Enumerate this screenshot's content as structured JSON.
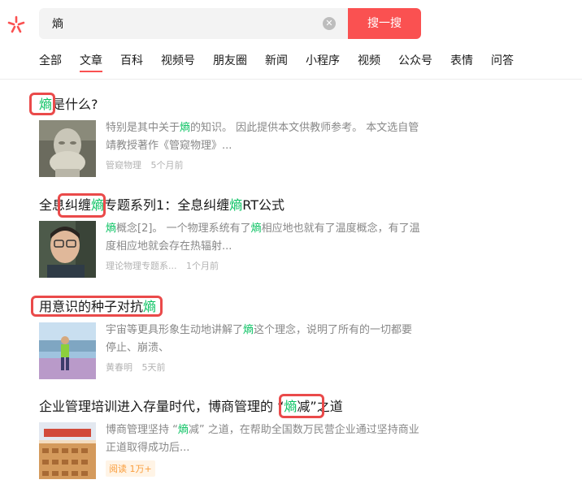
{
  "search": {
    "query": "熵",
    "button_label": "搜一搜"
  },
  "tabs": [
    "全部",
    "文章",
    "百科",
    "视频号",
    "朋友圈",
    "新闻",
    "小程序",
    "视频",
    "公众号",
    "表情",
    "问答"
  ],
  "results": [
    {
      "title_parts": [
        {
          "t": "熵",
          "h": true
        },
        {
          "t": "是什么?",
          "h": false
        }
      ],
      "snippet_parts": [
        {
          "t": "特别是其中关于",
          "h": false
        },
        {
          "t": "熵",
          "h": true
        },
        {
          "t": "的知识。 因此提供本文供教师参考。 本文选自管靖教授著作《管窥物理》...",
          "h": false
        }
      ],
      "source": "管窥物理",
      "time": "5个月前"
    },
    {
      "title_parts": [
        {
          "t": "全息纠缠",
          "h": false
        },
        {
          "t": "熵",
          "h": true
        },
        {
          "t": "专题系列1：全息纠缠",
          "h": false
        },
        {
          "t": "熵",
          "h": true
        },
        {
          "t": "RT公式",
          "h": false
        }
      ],
      "snippet_parts": [
        {
          "t": "熵",
          "h": true
        },
        {
          "t": "概念[2]。 一个物理系统有了",
          "h": false
        },
        {
          "t": "熵",
          "h": true
        },
        {
          "t": "相应地也就有了温度概念，有了温度相应地就会存在热辐射...",
          "h": false
        }
      ],
      "source": "理论物理专题系...",
      "time": "1个月前"
    },
    {
      "title_parts": [
        {
          "t": "用意识的种子对抗",
          "h": false
        },
        {
          "t": "熵",
          "h": true
        }
      ],
      "snippet_parts": [
        {
          "t": "宇宙等更具形象生动地讲解了",
          "h": false
        },
        {
          "t": "熵",
          "h": true
        },
        {
          "t": "这个理念，说明了所有的一切都要停止、崩溃、",
          "h": false
        }
      ],
      "source": "黄春明",
      "time": "5天前"
    },
    {
      "title_parts": [
        {
          "t": "企业管理培训进入存量时代，博商管理的 “",
          "h": false
        },
        {
          "t": "熵",
          "h": true
        },
        {
          "t": "减”之道",
          "h": false
        }
      ],
      "snippet_parts": [
        {
          "t": "博商管理坚持 “",
          "h": false
        },
        {
          "t": "熵",
          "h": true
        },
        {
          "t": "减” 之道，在帮助全国数万民营企业通过坚持商业正道取得成功后...",
          "h": false
        }
      ],
      "read_label": "阅读 1万+"
    }
  ]
}
